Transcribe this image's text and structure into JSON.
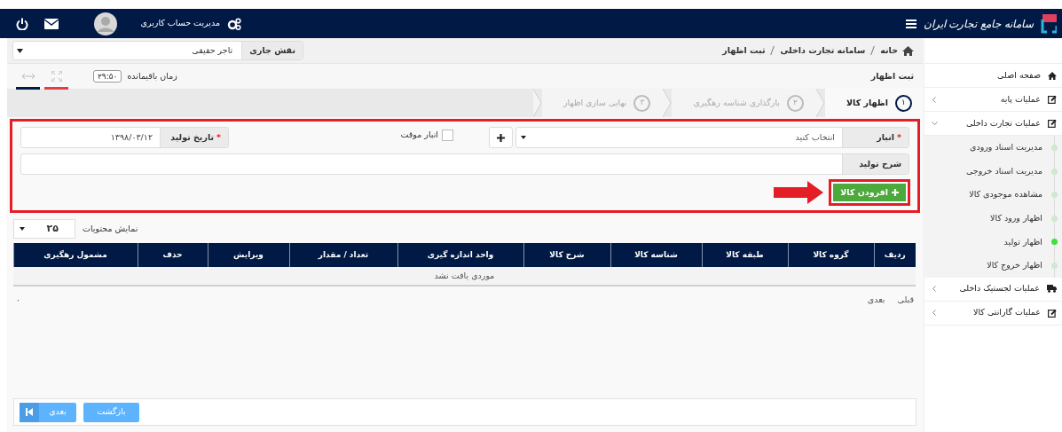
{
  "header": {
    "logo_text": "سامانه جامع تجارت ایران",
    "account_label": "مدیریت حساب کاربری"
  },
  "role": {
    "label": "نقش جاری",
    "value": "تاجر حقیقی"
  },
  "breadcrumb": [
    "خانه",
    "سامانه تجارت داخلی",
    "ثبت اظهار"
  ],
  "page_title": "ثبت اظهار",
  "timer": {
    "label": "زمان باقیمانده",
    "value": "۲۹:۵۰"
  },
  "steps": [
    {
      "number": "۱",
      "label": "اظهار کالا",
      "selected": true
    },
    {
      "number": "۲",
      "label": "بارگذاری شناسه رهگیری",
      "selected": false
    },
    {
      "number": "۳",
      "label": "نهایی سازی اظهار",
      "selected": false
    }
  ],
  "form": {
    "required_mark": "*",
    "warehouse": {
      "label": "انبار",
      "required": true,
      "placeholder": "انتخاب کنید"
    },
    "temp_warehouse": {
      "label": "انبار موقت",
      "checked": false
    },
    "production_date": {
      "label": "تاریخ تولید",
      "required": true,
      "value": "۱۳۹۸/۰۳/۱۲"
    },
    "description": {
      "label": "شرح تولید"
    },
    "add_button": "افزودن کالا"
  },
  "page_size": {
    "label": "نمایش محتویات",
    "value": "۲۵"
  },
  "table": {
    "columns": [
      "ردیف",
      "گروه کالا",
      "طبقه کالا",
      "شناسه کالا",
      "شرح کالا",
      "واحد اندازه گیری",
      "تعداد / مقدار",
      "ویرایش",
      "حذف",
      "مشمول رهگیری"
    ],
    "empty_text": "موردی یافت نشد"
  },
  "pager": {
    "previous": "قبلی",
    "next": "بعدی",
    "info": "۰"
  },
  "footer": {
    "back": "بازگشت",
    "next": "بعدی"
  },
  "sidebar": {
    "items": [
      {
        "label": "صفحه اصلی",
        "kind": "home"
      },
      {
        "label": "عملیات پایه",
        "kind": "group",
        "expanded": false
      },
      {
        "label": "عملیات تجارت داخلی",
        "kind": "group",
        "expanded": true,
        "children": [
          {
            "label": "مدیریت اسناد ورودی",
            "selected": false
          },
          {
            "label": "مدیریت اسناد خروجی",
            "selected": false
          },
          {
            "label": "مشاهده موجودی کالا",
            "selected": false
          },
          {
            "label": "اظهار ورود کالا",
            "selected": false
          },
          {
            "label": "اظهار تولید",
            "selected": true
          },
          {
            "label": "اظهار خروج کالا",
            "selected": false
          }
        ]
      },
      {
        "label": "عملیات لجستیک داخلی",
        "kind": "logistics",
        "expanded": false
      },
      {
        "label": "عملیات گارانتی کالا",
        "kind": "group",
        "expanded": false
      }
    ]
  }
}
